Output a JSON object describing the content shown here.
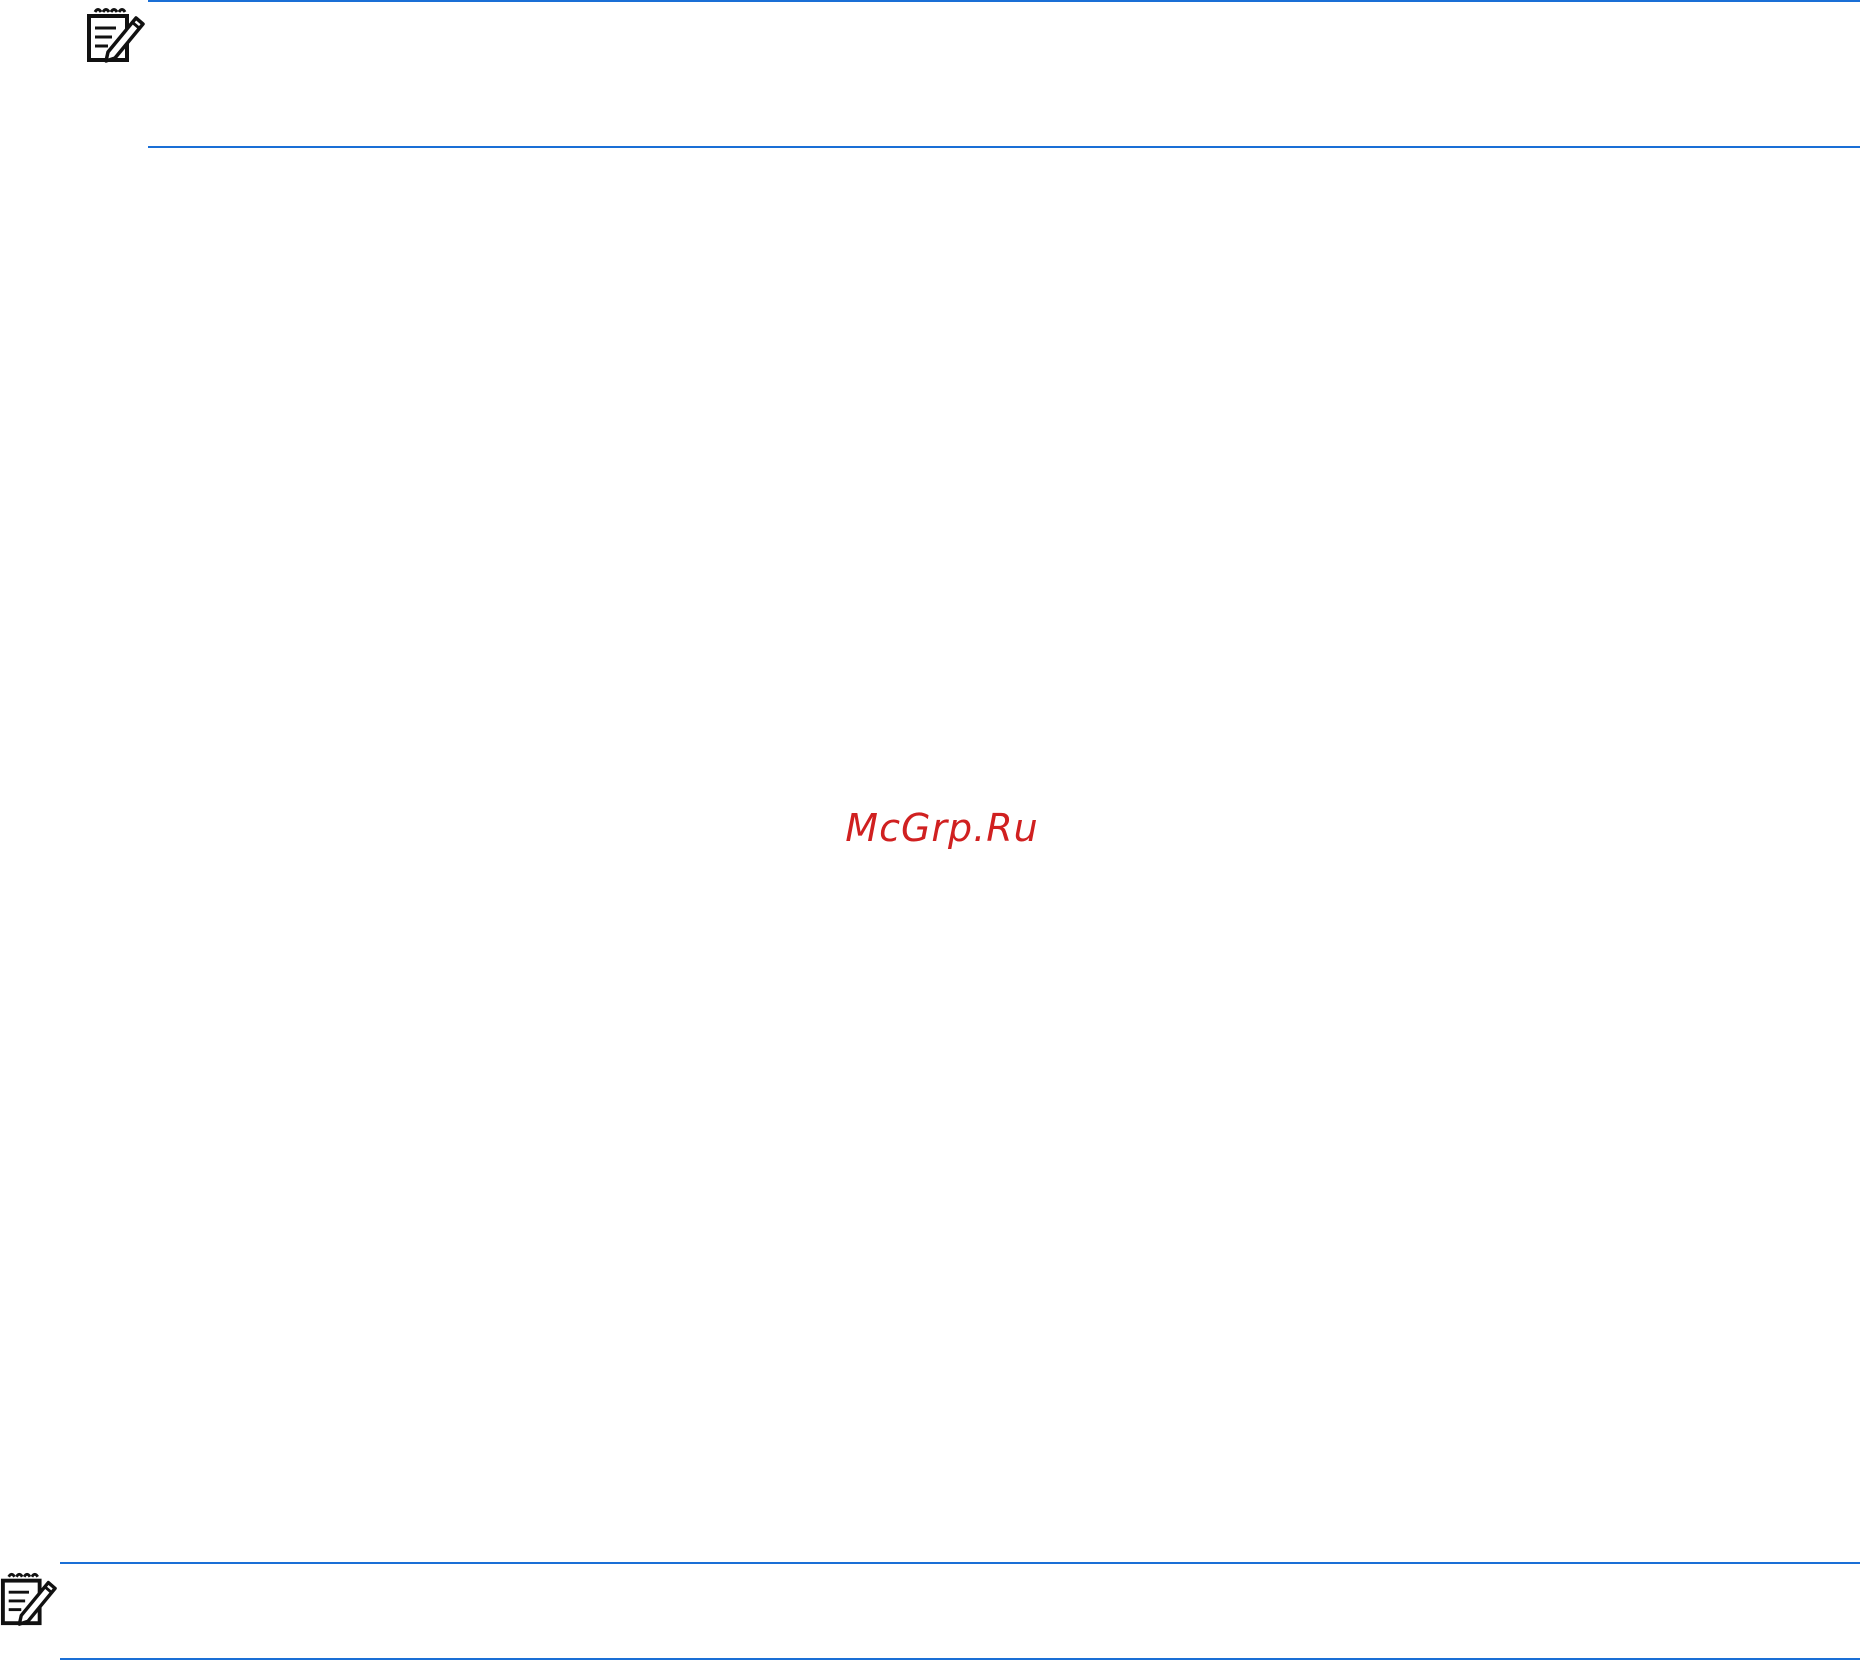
{
  "page": {
    "background": "#ffffff",
    "rule_color": "#1a6fd6"
  },
  "notes": [
    {
      "icon": "note-pencil-icon",
      "text": ""
    },
    {
      "icon": "note-pencil-icon",
      "text": ""
    }
  ],
  "watermark": {
    "text": "McGrp.Ru",
    "color": "#d02020"
  }
}
